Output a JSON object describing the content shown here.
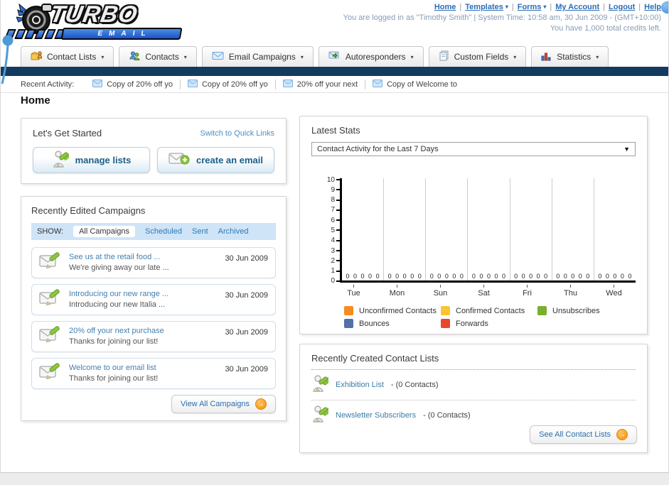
{
  "header": {
    "logo": {
      "title": "TURBO",
      "subtitle": "EMAIL"
    },
    "nav": [
      {
        "label": "Home",
        "dropdown": false
      },
      {
        "label": "Templates",
        "dropdown": true
      },
      {
        "label": "Forms",
        "dropdown": true
      },
      {
        "label": "My Account",
        "dropdown": false
      },
      {
        "label": "Logout",
        "dropdown": false
      },
      {
        "label": "Help",
        "dropdown": false
      }
    ],
    "login_line": "You are logged in as \"Timothy Smith\" | System Time: 10:58 am, 30 Jun 2009 - (GMT+10:00)",
    "credits_line": "You have 1,000 total credits left."
  },
  "tabs": [
    {
      "label": "Contact Lists",
      "icon": "contact-lists-icon"
    },
    {
      "label": "Contacts",
      "icon": "contacts-icon"
    },
    {
      "label": "Email Campaigns",
      "icon": "email-campaigns-icon"
    },
    {
      "label": "Autoresponders",
      "icon": "autoresponders-icon"
    },
    {
      "label": "Custom Fields",
      "icon": "custom-fields-icon"
    },
    {
      "label": "Statistics",
      "icon": "statistics-icon"
    }
  ],
  "recent_activity": {
    "label": "Recent Activity:",
    "items": [
      "Copy of 20% off yo",
      "Copy of 20% off yo",
      "20% off your next",
      "Copy of Welcome to"
    ]
  },
  "page_title": "Home",
  "get_started": {
    "title": "Let's Get Started",
    "switch_link": "Switch to Quick Links",
    "buttons": [
      {
        "label": "manage lists",
        "icon": "person-pencil-icon"
      },
      {
        "label": "create an email",
        "icon": "envelope-plus-icon"
      }
    ]
  },
  "campaigns": {
    "title": "Recently Edited Campaigns",
    "show_label": "SHOW:",
    "filters": [
      {
        "label": "All Campaigns",
        "selected": true
      },
      {
        "label": "Scheduled",
        "selected": false
      },
      {
        "label": "Sent",
        "selected": false
      },
      {
        "label": "Archived",
        "selected": false
      }
    ],
    "items": [
      {
        "title": "See us at the retail food ...",
        "subtitle": "We're giving away our late ...",
        "date": "30 Jun 2009"
      },
      {
        "title": "Introducing our new range ...",
        "subtitle": "Introducing our new Italia ...",
        "date": "30 Jun 2009"
      },
      {
        "title": "20% off your next purchase",
        "subtitle": "Thanks for joining our list!",
        "date": "30 Jun 2009"
      },
      {
        "title": "Welcome to our email list",
        "subtitle": "Thanks for joining our list!",
        "date": "30 Jun 2009"
      }
    ],
    "view_all_label": "View All Campaigns"
  },
  "latest_stats": {
    "title": "Latest Stats",
    "dropdown_value": "Contact Activity for the Last 7 Days"
  },
  "chart_data": {
    "type": "bar",
    "title": "Contact Activity for the Last 7 Days",
    "categories": [
      "Tue",
      "Mon",
      "Sun",
      "Sat",
      "Fri",
      "Thu",
      "Wed"
    ],
    "series": [
      {
        "name": "Unconfirmed Contacts",
        "color": "#f68b1f",
        "values": [
          0,
          0,
          0,
          0,
          0,
          0,
          0
        ]
      },
      {
        "name": "Confirmed Contacts",
        "color": "#fbc433",
        "values": [
          0,
          0,
          0,
          0,
          0,
          0,
          0
        ]
      },
      {
        "name": "Unsubscribes",
        "color": "#7ab02e",
        "values": [
          0,
          0,
          0,
          0,
          0,
          0,
          0
        ]
      },
      {
        "name": "Bounces",
        "color": "#5470a8",
        "values": [
          0,
          0,
          0,
          0,
          0,
          0,
          0
        ]
      },
      {
        "name": "Forwards",
        "color": "#e8472b",
        "values": [
          0,
          0,
          0,
          0,
          0,
          0,
          0
        ]
      }
    ],
    "ylim": [
      0,
      10
    ],
    "yticks": [
      0,
      1,
      2,
      3,
      4,
      5,
      6,
      7,
      8,
      9,
      10
    ],
    "grid": "vertical",
    "legend_position": "bottom"
  },
  "contact_lists": {
    "title": "Recently Created Contact Lists",
    "items": [
      {
        "name": "Exhibition List",
        "detail": "- (0 Contacts)"
      },
      {
        "name": "Newsletter Subscribers",
        "detail": "- (0 Contacts)"
      }
    ],
    "see_all_label": "See All Contact Lists"
  }
}
